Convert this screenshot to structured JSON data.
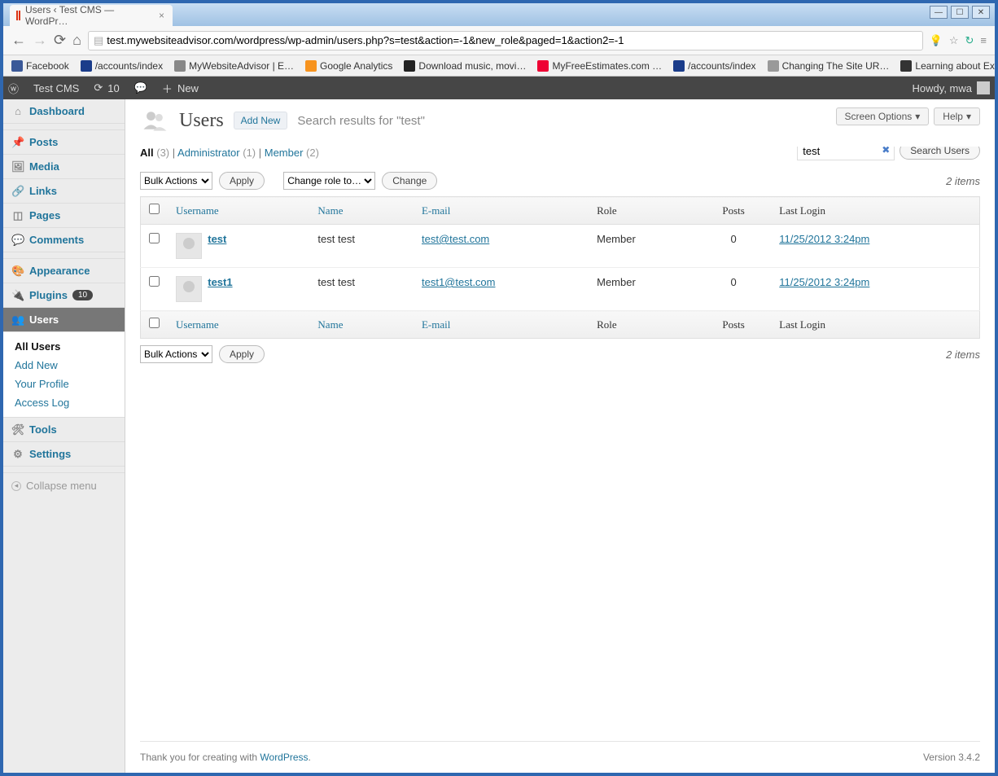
{
  "browser": {
    "tabTitle": "Users ‹ Test CMS — WordPr…",
    "url": "test.mywebsiteadvisor.com/wordpress/wp-admin/users.php?s=test&action=-1&new_role&paged=1&action2=-1",
    "bookmarks": [
      {
        "label": "Facebook",
        "color": "#3b5998"
      },
      {
        "label": "/accounts/index",
        "color": "#1a3c8a"
      },
      {
        "label": "MyWebsiteAdvisor | E…",
        "color": "#888"
      },
      {
        "label": "Google Analytics",
        "color": "#f7931e"
      },
      {
        "label": "Download music, movi…",
        "color": "#222"
      },
      {
        "label": "MyFreeEstimates.com …",
        "color": "#e03"
      },
      {
        "label": "/accounts/index",
        "color": "#1a3c8a"
      },
      {
        "label": "Changing The Site UR…",
        "color": "#999"
      },
      {
        "label": "Learning about Expos…",
        "color": "#333"
      }
    ]
  },
  "adminbar": {
    "site": "Test CMS",
    "updates": "10",
    "new": "New",
    "howdy": "Howdy, mwa"
  },
  "sidebar": {
    "items": [
      {
        "label": "Dashboard",
        "icon": "⌂"
      },
      {
        "label": "Posts",
        "icon": "📌"
      },
      {
        "label": "Media",
        "icon": "🖼"
      },
      {
        "label": "Links",
        "icon": "🔗"
      },
      {
        "label": "Pages",
        "icon": "◫"
      },
      {
        "label": "Comments",
        "icon": "💬"
      },
      {
        "label": "Appearance",
        "icon": "🎨"
      },
      {
        "label": "Plugins",
        "icon": "🔌",
        "badge": "10"
      },
      {
        "label": "Users",
        "icon": "👥",
        "current": true
      },
      {
        "label": "Tools",
        "icon": "🛠"
      },
      {
        "label": "Settings",
        "icon": "⚙"
      }
    ],
    "submenu": {
      "allUsers": "All Users",
      "addNew": "Add New",
      "profile": "Your Profile",
      "accessLog": "Access Log"
    },
    "collapse": "Collapse menu"
  },
  "page": {
    "title": "Users",
    "addNew": "Add New",
    "subtitle": "Search results for \"test\"",
    "screenOptions": "Screen Options",
    "help": "Help",
    "filters": {
      "all": "All",
      "allCount": "(3)",
      "admin": "Administrator",
      "adminCount": "(1)",
      "member": "Member",
      "memberCount": "(2)"
    },
    "search": {
      "value": "test",
      "button": "Search Users"
    },
    "bulk": {
      "bulkActions": "Bulk Actions",
      "apply": "Apply",
      "changeRole": "Change role to…",
      "change": "Change"
    },
    "items": "2 items",
    "columns": {
      "username": "Username",
      "name": "Name",
      "email": "E-mail",
      "role": "Role",
      "posts": "Posts",
      "lastLogin": "Last Login"
    },
    "rows": [
      {
        "username": "test",
        "name": "test test",
        "email": "test@test.com",
        "role": "Member",
        "posts": "0",
        "lastLogin": "11/25/2012 3:24pm"
      },
      {
        "username": "test1",
        "name": "test test",
        "email": "test1@test.com",
        "role": "Member",
        "posts": "0",
        "lastLogin": "11/25/2012 3:24pm"
      }
    ]
  },
  "footer": {
    "left1": "Thank you for creating with ",
    "wp": "WordPress",
    "version": "Version 3.4.2"
  }
}
